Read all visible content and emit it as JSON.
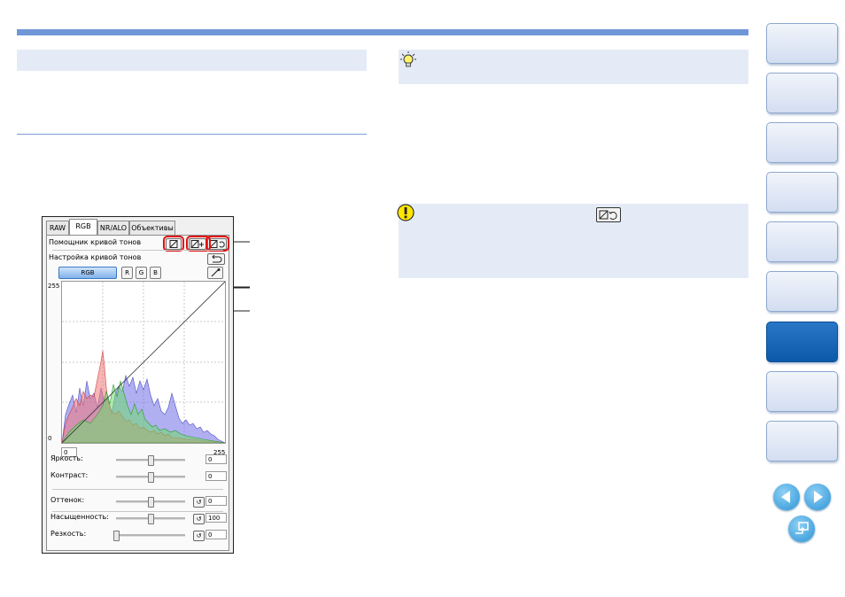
{
  "dialog": {
    "tabs": [
      "RAW",
      "RGB",
      "NR/ALO",
      "Объективы"
    ],
    "active_tab": "RGB",
    "curve_assist_label": "Помощник кривой тонов",
    "curve_adjust_label": "Настройка кривой тонов",
    "channels": [
      "RGB",
      "R",
      "G",
      "B"
    ],
    "selected_channel": "RGB",
    "axis": {
      "y_top": "255",
      "y_bottom": "0",
      "x_left": "0",
      "x_right": "255"
    },
    "sliders": [
      {
        "label": "Яркость:",
        "value": "0",
        "level": 0.5,
        "reset": false
      },
      {
        "label": "Контраст:",
        "value": "0",
        "level": 0.5,
        "reset": false
      },
      {
        "label": "Оттенок:",
        "value": "0",
        "level": 0.5,
        "reset": true
      },
      {
        "label": "Насыщенность:",
        "value": "100",
        "level": 0.5,
        "reset": true
      },
      {
        "label": "Резкость:",
        "value": "0",
        "level": 0.0,
        "reset": true
      }
    ]
  },
  "icons": {
    "hint": "lightbulb-icon",
    "caution": "warning-icon"
  },
  "nav": {
    "buttons": [
      "",
      "",
      "",
      "",
      "",
      "",
      "",
      "",
      ""
    ],
    "active_index": 6
  }
}
